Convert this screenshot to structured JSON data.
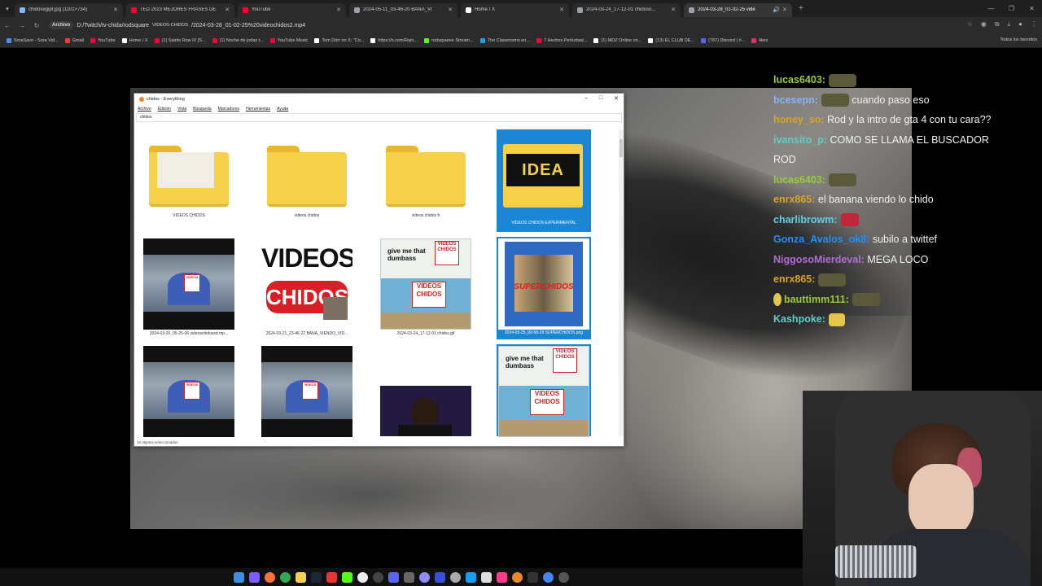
{
  "browser": {
    "tabs": [
      {
        "label": "chidosegipt.jpg (1101×734)",
        "color": "#8ab4f8",
        "active": false
      },
      {
        "label": "TED 2023 MEJORES FRASES DE",
        "color": "#ff0033",
        "active": false
      },
      {
        "label": "YouTube",
        "color": "#ff0033",
        "active": false
      },
      {
        "label": "2024-05-11_03-46-20 BANA_VI",
        "color": "#9aa0a6",
        "active": false
      },
      {
        "label": "Home / X",
        "color": "#ffffff",
        "active": false
      },
      {
        "label": "2024-03-24_17-12-01 chidoso...",
        "color": "#9aa0a6",
        "active": false
      },
      {
        "label": "2024-03-28_01-02-25 vide",
        "color": "#9aa0a6",
        "active": true
      }
    ],
    "address_chip": "Archivo",
    "url_text": "D:/Twitch/tv-chida/rodsquare",
    "url_mid": "VIDEOS-CHIDOS",
    "url_end": "/2024-03-28_01-02-25%20videochidos2.mp4",
    "bookmarks": [
      {
        "label": "SoraSave - Sora Vid...",
        "color": "#4a8fe7"
      },
      {
        "label": "Gmail",
        "color": "#ea4335"
      },
      {
        "label": "YouTube",
        "color": "#ff0033"
      },
      {
        "label": "Home / X",
        "color": "#ffffff"
      },
      {
        "label": "(1) Saints Row IV [S...",
        "color": "#ff0033"
      },
      {
        "label": "(1) Noche de jodas t...",
        "color": "#ff0033"
      },
      {
        "label": "YouTube Music",
        "color": "#ff0033"
      },
      {
        "label": "Tom Dörr on X: \"Co...",
        "color": "#ffffff"
      },
      {
        "label": "https://x.com/Rain...",
        "color": "#ffffff"
      },
      {
        "label": "rodsquaree Stream...",
        "color": "#53fc18"
      },
      {
        "label": "The Classrooms en...",
        "color": "#1b9df0"
      },
      {
        "label": "7 Hechos Perturbad...",
        "color": "#ff0033"
      },
      {
        "label": "(1) MDZ Online on...",
        "color": "#ffffff"
      },
      {
        "label": "(13) EL CLUB DE...",
        "color": "#ffffff"
      },
      {
        "label": "(787) Discord | #...",
        "color": "#5865f2"
      },
      {
        "label": "likes",
        "color": "#e1306c"
      }
    ],
    "all_bookmarks": "Todos los favoritos"
  },
  "everything": {
    "title": "chidos - Everything",
    "menu": [
      "Archivo",
      "Edición",
      "Vista",
      "Búsqueda",
      "Marcadores",
      "Herramientas",
      "Ayuda"
    ],
    "search_value": "chidos",
    "status": "10 objetos seleccionados",
    "items": [
      {
        "caption": "VIDEOS CHIDOS"
      },
      {
        "caption": "videos chidos"
      },
      {
        "caption": "videos chidos b"
      },
      {
        "caption": "VIDEOS CHIDOS EXPERIMENTAL"
      },
      {
        "caption": "2024-03-20_05-25-06 videoschidosxd.mp..."
      },
      {
        "caption": "2024-03-21_23-46-22 BANA_VIENDO_VID..."
      },
      {
        "caption": "2024-03-24_17-12-01 chidos.gif"
      },
      {
        "caption": "2024-03-25_00-58-29 SUPERCHIDOS.png"
      },
      {
        "caption": ""
      },
      {
        "caption": ""
      },
      {
        "caption": ""
      },
      {
        "caption": ""
      }
    ],
    "thumb_texts": {
      "videos": "VIDEOS",
      "chidos": "CHIDOS",
      "meme_line1": "give me that",
      "meme_line2": "dumbass",
      "super": "SUPERCHIDOS",
      "idea": "IDEA"
    }
  },
  "chat": [
    {
      "user": "lucas6403:",
      "color": "#9acd32",
      "text": "",
      "emote": true
    },
    {
      "user": "bcesepn:",
      "color": "#8ab4f8",
      "text": "cuando paso eso",
      "emote": true
    },
    {
      "user": "honey_so:",
      "color": "#daa520",
      "text": "Rod y la intro de gta 4 con tu cara??",
      "emote": false
    },
    {
      "user": "ivansito_p:",
      "color": "#5fcfc8",
      "text": "COMO SE LLAMA EL BUSCADOR ROD",
      "emote": false
    },
    {
      "user": "lucas6403:",
      "color": "#9acd32",
      "text": "",
      "emote": true
    },
    {
      "user": "enrx865:",
      "color": "#daa520",
      "text": "el banana viendo lo chido",
      "emote": false
    },
    {
      "user": "charlibrowm:",
      "color": "#5fcfe8",
      "text": "",
      "emote": true
    },
    {
      "user": "Gonza_Avalos_ok8:",
      "color": "#1e90ff",
      "text": "subilo a twittef",
      "emote": false
    },
    {
      "user": "NiggosoMierdeval:",
      "color": "#b36bd6",
      "text": "MEGA LOCO",
      "emote": false
    },
    {
      "user": "enrx865:",
      "color": "#daa520",
      "text": "",
      "emote": true
    },
    {
      "user": "bauttimm111:",
      "color": "#9acd32",
      "text": "",
      "emote": true
    },
    {
      "user": "Kashpoke:",
      "color": "#5fcfc8",
      "text": "",
      "emote": true
    }
  ]
}
